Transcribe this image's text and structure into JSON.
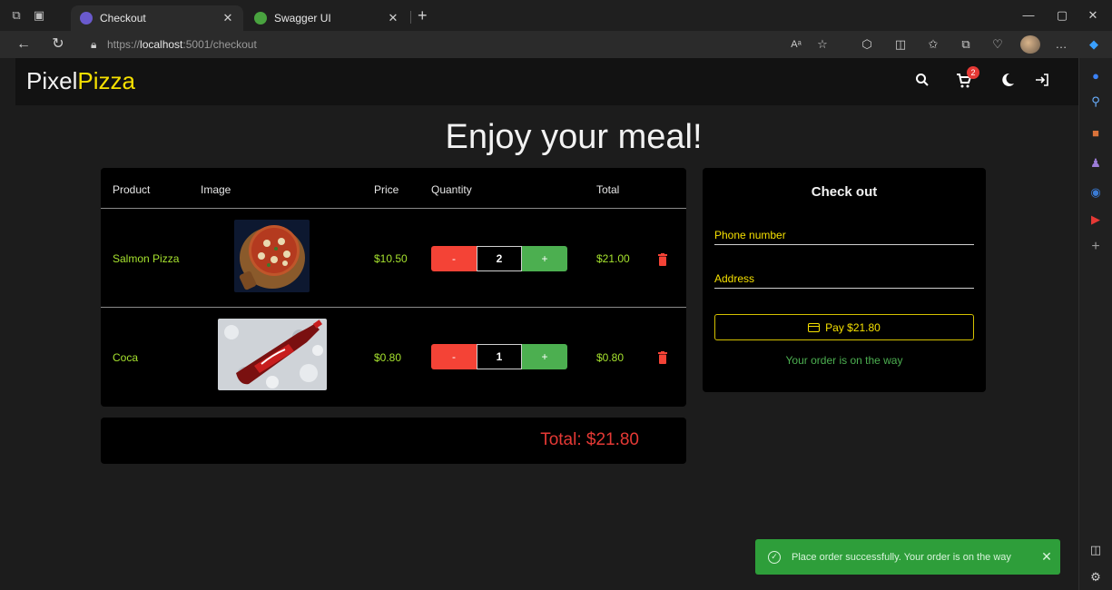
{
  "browser": {
    "tabs": [
      {
        "label": "Checkout",
        "active": true
      },
      {
        "label": "Swagger UI",
        "active": false
      }
    ],
    "url_prefix": "https://",
    "url_host": "localhost",
    "url_rest": ":5001/checkout",
    "read_aloud_label": "Aᵃ"
  },
  "app": {
    "brand_a": "Pixel",
    "brand_b": "Pizza",
    "cart_count": "2",
    "heading": "Enjoy your meal!"
  },
  "cart": {
    "headers": {
      "product": "Product",
      "image": "Image",
      "price": "Price",
      "quantity": "Quantity",
      "total": "Total"
    },
    "minus_label": "-",
    "plus_label": "+",
    "items": [
      {
        "name": "Salmon Pizza",
        "price": "$10.50",
        "quantity": "2",
        "total": "$21.00"
      },
      {
        "name": "Coca",
        "price": "$0.80",
        "quantity": "1",
        "total": "$0.80"
      }
    ],
    "grand_total": "Total: $21.80"
  },
  "checkout": {
    "title": "Check out",
    "phone_label": "Phone number",
    "address_label": "Address",
    "pay_label": "Pay $21.80",
    "order_msg": "Your order is on the way"
  },
  "toast": {
    "message": "Place order successfully. Your order is on the way"
  },
  "colors": {
    "brand_accent": "#f5e000",
    "success": "#4caf50",
    "danger": "#f44336",
    "price_green": "#a6e22e"
  }
}
